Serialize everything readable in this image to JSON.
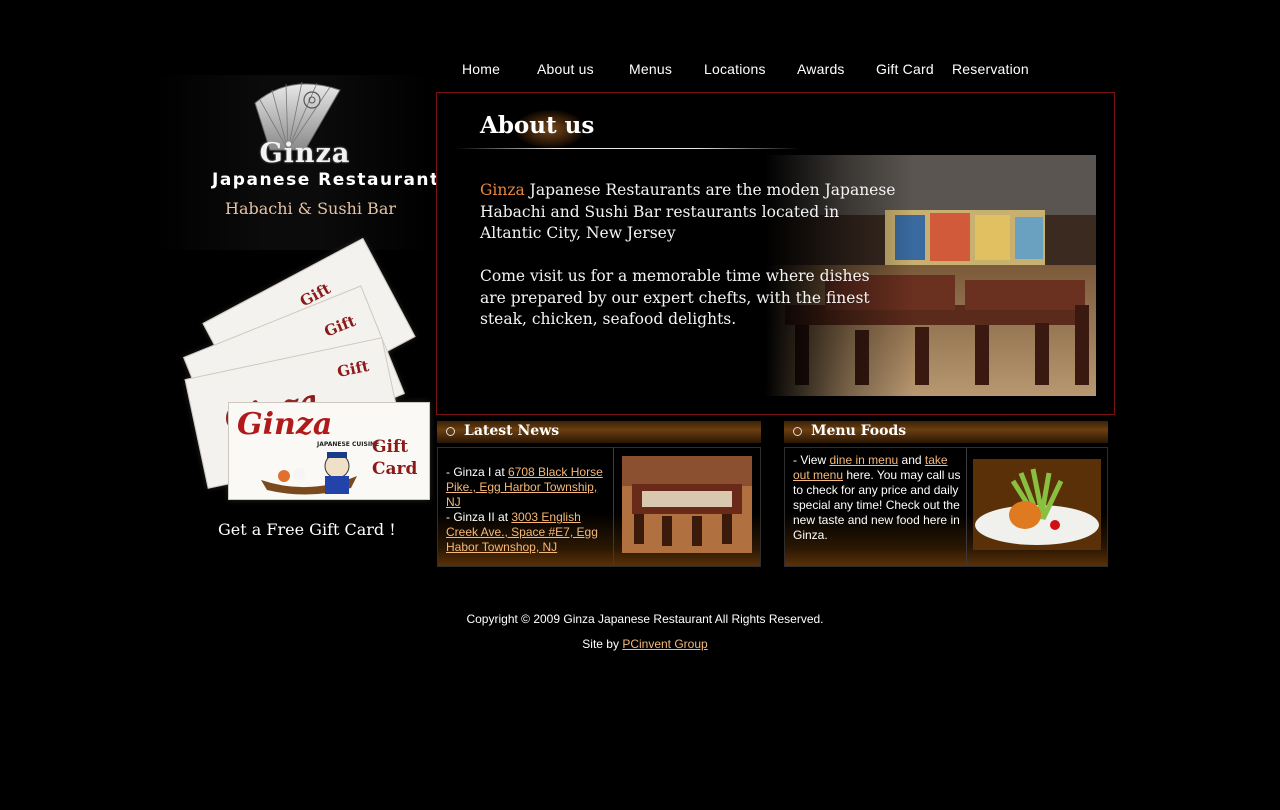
{
  "nav": {
    "items": [
      "Home",
      "About us",
      "Menus",
      "Locations",
      "Awards",
      "Gift Card",
      "Reservation"
    ]
  },
  "logo": {
    "name": "Ginza",
    "subtitle": "Japanese Restaurant",
    "tagline": "Habachi & Sushi Bar"
  },
  "gift": {
    "card_brand": "Ginza",
    "card_label_1": "Gift",
    "card_label_2": "Card",
    "card_small": "JAPANESE CUISINE",
    "caption": "Get a Free Gift Card !"
  },
  "about": {
    "title": "About us",
    "brand": "Ginza",
    "para1_rest": " Japanese Restaurants are the moden Japanese Habachi and Sushi Bar restaurants located in  Altantic City, New Jersey",
    "para2": "Come visit us for a memorable time where dishes are prepared by our expert chefts, with the finest steak, chicken, seafood delights."
  },
  "latest_news": {
    "title": "Latest News",
    "line1_prefix": "- Ginza I at ",
    "line1_link": "6708 Black Horse Pike., Egg Harbor Township, NJ",
    "line2_prefix": "- Ginza II at ",
    "line2_link": "3003 English Creek Ave., Space #E7, Egg Habor Townshop, NJ"
  },
  "menu_foods": {
    "title": "Menu Foods",
    "prefix": "- View ",
    "link1": "dine in menu",
    "mid": " and ",
    "link2": "take out menu",
    "rest": " here. You may call us to check for any price and daily special any time! Check out the new taste and new food here in Ginza."
  },
  "footer": {
    "copyright": "Copyright © 2009 Ginza Japanese Restaurant  All Rights Reserved.",
    "site_by": "Site by ",
    "site_link": "PCinvent Group"
  },
  "colors": {
    "accent": "#e7863a",
    "link": "#f5b878",
    "panel_border": "#7a1414",
    "card_red": "#8b1a1a"
  }
}
